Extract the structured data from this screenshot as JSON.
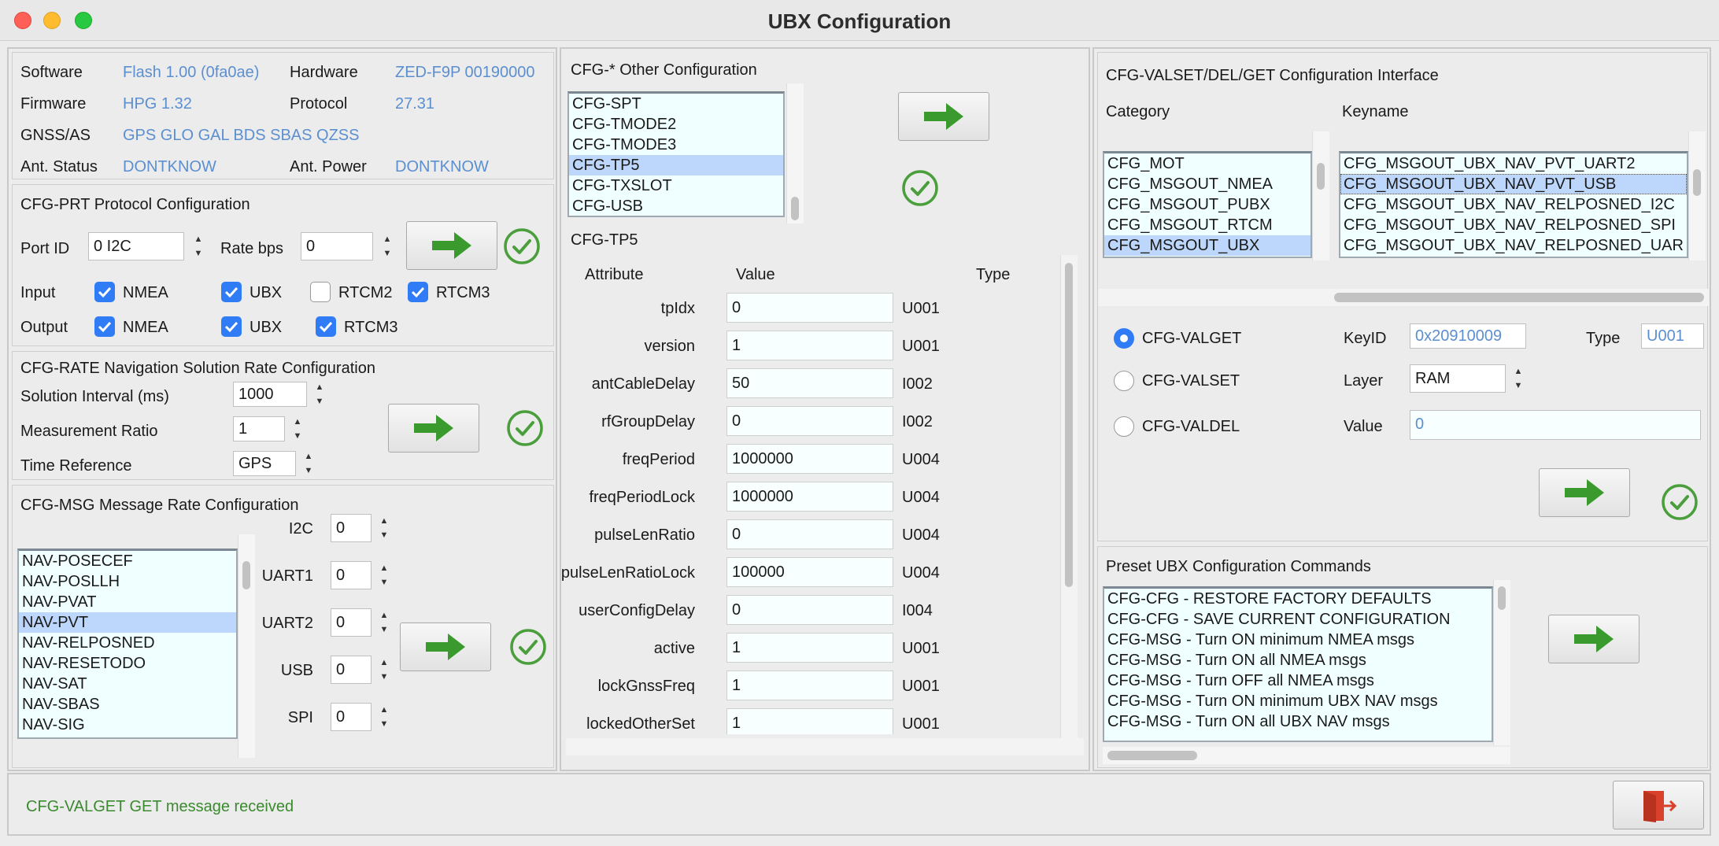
{
  "window": {
    "title": "UBX Configuration"
  },
  "info": {
    "software_label": "Software",
    "software_value": "Flash 1.00 (0fa0ae)",
    "hardware_label": "Hardware",
    "hardware_value": "ZED-F9P 00190000",
    "firmware_label": "Firmware",
    "firmware_value": "HPG 1.32",
    "protocol_label": "Protocol",
    "protocol_value": "27.31",
    "gnss_label": "GNSS/AS",
    "gnss_value": "GPS GLO GAL BDS SBAS QZSS",
    "antstatus_label": "Ant. Status",
    "antstatus_value": "DONTKNOW",
    "antpower_label": "Ant. Power",
    "antpower_value": "DONTKNOW"
  },
  "prt": {
    "title": "CFG-PRT Protocol Configuration",
    "port_label": "Port ID",
    "port_value": "0 I2C",
    "rate_label": "Rate bps",
    "rate_value": "0",
    "input_label": "Input",
    "output_label": "Output",
    "input": [
      {
        "label": "NMEA",
        "checked": true
      },
      {
        "label": "UBX",
        "checked": true
      },
      {
        "label": "RTCM2",
        "checked": false
      },
      {
        "label": "RTCM3",
        "checked": true
      }
    ],
    "output": [
      {
        "label": "NMEA",
        "checked": true
      },
      {
        "label": "UBX",
        "checked": true
      },
      {
        "label": "RTCM3",
        "checked": true
      }
    ]
  },
  "rate": {
    "title": "CFG-RATE Navigation Solution Rate Configuration",
    "interval_label": "Solution Interval (ms)",
    "interval_value": "1000",
    "ratio_label": "Measurement Ratio",
    "ratio_value": "1",
    "timeref_label": "Time Reference",
    "timeref_value": "GPS"
  },
  "msg": {
    "title": "CFG-MSG Message Rate Configuration",
    "items": [
      "NAV-POSECEF",
      "NAV-POSLLH",
      "NAV-PVAT",
      "NAV-PVT",
      "NAV-RELPOSNED",
      "NAV-RESETODO",
      "NAV-SAT",
      "NAV-SBAS",
      "NAV-SIG"
    ],
    "selected_index": 3,
    "ports": [
      {
        "label": "I2C",
        "value": "0"
      },
      {
        "label": "UART1",
        "value": "0"
      },
      {
        "label": "UART2",
        "value": "0"
      },
      {
        "label": "USB",
        "value": "0"
      },
      {
        "label": "SPI",
        "value": "0"
      }
    ]
  },
  "other": {
    "title": "CFG-* Other Configuration",
    "items": [
      "CFG-SPT",
      "CFG-TMODE2",
      "CFG-TMODE3",
      "CFG-TP5",
      "CFG-TXSLOT",
      "CFG-USB"
    ],
    "selected_index": 3,
    "subtitle": "CFG-TP5",
    "col_attribute": "Attribute",
    "col_value": "Value",
    "col_type": "Type",
    "rows": [
      {
        "name": "tpIdx",
        "value": "0",
        "type": "U001"
      },
      {
        "name": "version",
        "value": "1",
        "type": "U001"
      },
      {
        "name": "antCableDelay",
        "value": "50",
        "type": "I002"
      },
      {
        "name": "rfGroupDelay",
        "value": "0",
        "type": "I002"
      },
      {
        "name": "freqPeriod",
        "value": "1000000",
        "type": "U004"
      },
      {
        "name": "freqPeriodLock",
        "value": "1000000",
        "type": "U004"
      },
      {
        "name": "pulseLenRatio",
        "value": "0",
        "type": "U004"
      },
      {
        "name": "pulseLenRatioLock",
        "value": "100000",
        "type": "U004"
      },
      {
        "name": "userConfigDelay",
        "value": "0",
        "type": "I004"
      },
      {
        "name": "active",
        "value": "1",
        "type": "U001"
      },
      {
        "name": "lockGnssFreq",
        "value": "1",
        "type": "U001"
      },
      {
        "name": "lockedOtherSet",
        "value": "1",
        "type": "U001"
      }
    ]
  },
  "valset": {
    "title": "CFG-VALSET/DEL/GET Configuration Interface",
    "category_label": "Category",
    "keyname_label": "Keyname",
    "categories": [
      "CFG_MOT",
      "CFG_MSGOUT_NMEA",
      "CFG_MSGOUT_PUBX",
      "CFG_MSGOUT_RTCM",
      "CFG_MSGOUT_UBX"
    ],
    "category_selected": 4,
    "keynames": [
      "CFG_MSGOUT_UBX_NAV_PVT_UART2",
      "CFG_MSGOUT_UBX_NAV_PVT_USB",
      "CFG_MSGOUT_UBX_NAV_RELPOSNED_I2C",
      "CFG_MSGOUT_UBX_NAV_RELPOSNED_SPI",
      "CFG_MSGOUT_UBX_NAV_RELPOSNED_UAR"
    ],
    "keyname_selected": 1,
    "valget_label": "CFG-VALGET",
    "valset_label": "CFG-VALSET",
    "valdel_label": "CFG-VALDEL",
    "keyid_label": "KeyID",
    "keyid_value": "0x20910009",
    "type_label": "Type",
    "type_value": "U001",
    "layer_label": "Layer",
    "layer_value": "RAM",
    "value_label": "Value",
    "value_value": "0"
  },
  "preset": {
    "title": "Preset UBX Configuration Commands",
    "items": [
      "CFG-CFG - RESTORE FACTORY DEFAULTS",
      "CFG-CFG - SAVE CURRENT CONFIGURATION",
      "CFG-MSG - Turn ON minimum NMEA msgs",
      "CFG-MSG - Turn ON all NMEA msgs",
      "CFG-MSG - Turn OFF all NMEA msgs",
      "CFG-MSG - Turn ON minimum UBX NAV msgs",
      "CFG-MSG - Turn ON all UBX NAV msgs"
    ]
  },
  "status": {
    "message": "CFG-VALGET GET message received"
  },
  "icons": {
    "send": "right-arrow-icon",
    "ok": "check-circle-icon",
    "exit": "exit-door-icon"
  },
  "colors": {
    "accent": "#2f7cf6",
    "arrow": "#3a9a2e",
    "ok": "#4a9e3c",
    "list_bg": "#f0ffff",
    "list_sel": "#bcd7fb",
    "status": "#3a8a2e"
  }
}
